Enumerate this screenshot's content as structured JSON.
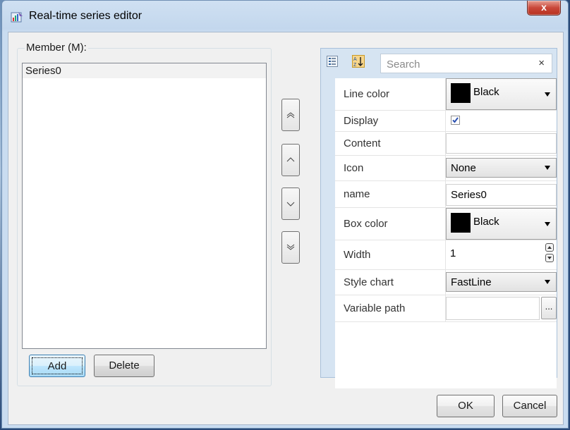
{
  "window": {
    "title": "Real-time series editor",
    "close_glyph": "x"
  },
  "members": {
    "legend": "Member (M):",
    "items": [
      "Series0"
    ],
    "add_label": "Add",
    "delete_label": "Delete"
  },
  "search": {
    "placeholder": "Search",
    "clear_glyph": "×"
  },
  "properties": {
    "line_color": {
      "label": "Line color",
      "value": "Black",
      "swatch": "#000000"
    },
    "display": {
      "label": "Display",
      "checked": true
    },
    "content": {
      "label": "Content",
      "value": ""
    },
    "icon": {
      "label": "Icon",
      "value": "None"
    },
    "name": {
      "label": "name",
      "value": "Series0"
    },
    "box_color": {
      "label": "Box color",
      "value": "Black",
      "swatch": "#000000"
    },
    "width": {
      "label": "Width",
      "value": "1"
    },
    "style_chart": {
      "label": "Style chart",
      "value": "FastLine"
    },
    "variable_path": {
      "label": "Variable path",
      "value": "",
      "browse_label": "..."
    }
  },
  "footer": {
    "ok_label": "OK",
    "cancel_label": "Cancel"
  }
}
